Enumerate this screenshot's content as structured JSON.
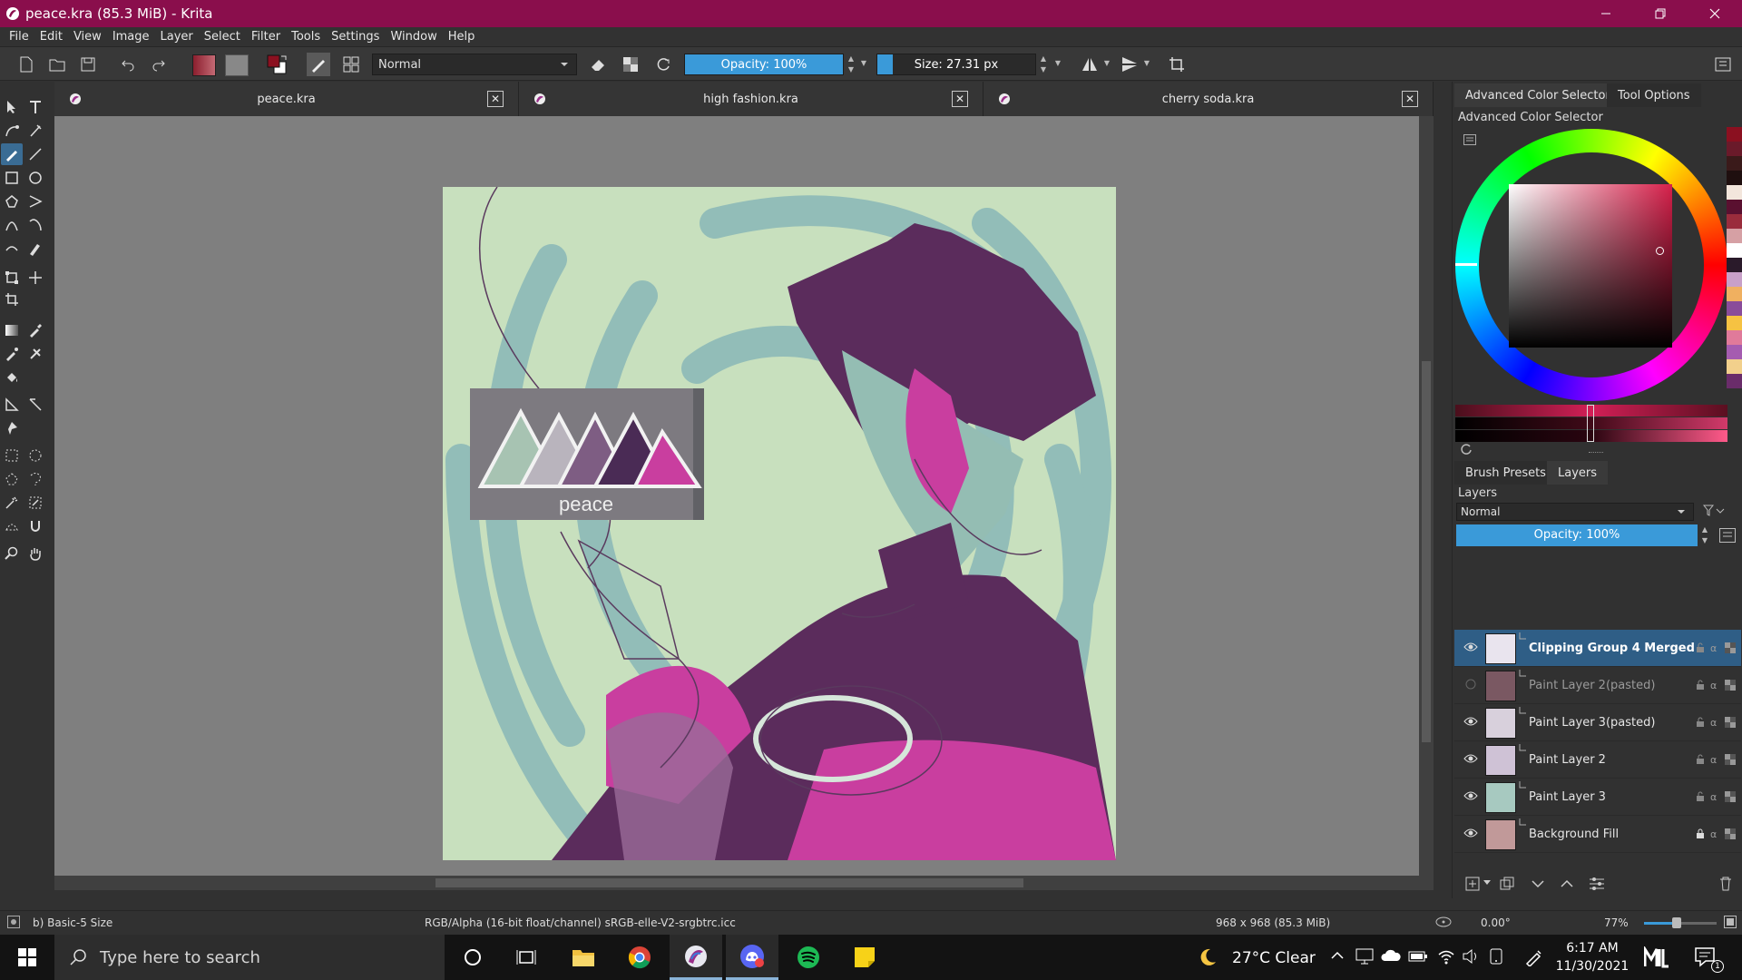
{
  "window": {
    "title": "peace.kra (85.3 MiB) - Krita",
    "accent_color": "#8a0e4c"
  },
  "menu": [
    "File",
    "Edit",
    "View",
    "Image",
    "Layer",
    "Select",
    "Filter",
    "Tools",
    "Settings",
    "Window",
    "Help"
  ],
  "toolbar": {
    "blend_mode": "Normal",
    "opacity_label": "Opacity: 100%",
    "opacity_value": 100,
    "size_label": "Size: 27.31 px",
    "size_fraction": 0.1
  },
  "document_tabs": [
    {
      "label": "peace.kra"
    },
    {
      "label": "high fashion.kra"
    },
    {
      "label": "cherry soda.kra"
    }
  ],
  "artwork": {
    "sign_text": "peace"
  },
  "dock": {
    "top_tabs": [
      "Advanced Color Selector",
      "Tool Options"
    ],
    "color_selector_title": "Advanced Color Selector",
    "bottom_tabs": [
      "Brush Presets",
      "Layers"
    ],
    "layers_title": "Layers",
    "layer_blend_mode": "Normal",
    "layer_opacity_label": "Opacity:  100%",
    "layers": [
      {
        "name": "Clipping Group 4 Merged",
        "visible": true,
        "selected": true,
        "locked": false,
        "thumb": "#e9e4ee"
      },
      {
        "name": "Paint Layer 2(pasted)",
        "visible": false,
        "selected": false,
        "locked": false,
        "thumb": "#7a5862"
      },
      {
        "name": "Paint Layer 3(pasted)",
        "visible": true,
        "selected": false,
        "locked": false,
        "thumb": "#d8d0dc"
      },
      {
        "name": "Paint Layer 2",
        "visible": true,
        "selected": false,
        "locked": false,
        "thumb": "#cfc2d6"
      },
      {
        "name": "Paint Layer 3",
        "visible": true,
        "selected": false,
        "locked": false,
        "thumb": "#a7c9c0"
      },
      {
        "name": "Background Fill",
        "visible": true,
        "selected": false,
        "locked": true,
        "thumb": "#c19999"
      }
    ]
  },
  "status": {
    "brush": "b) Basic-5 Size",
    "color_space": "RGB/Alpha (16-bit float/channel)  sRGB-elle-V2-srgbtrc.icc",
    "image_size": "968 x 968 (85.3 MiB)",
    "rotation": "0.00°",
    "zoom": "77%",
    "zoom_fraction": 0.45
  },
  "taskbar": {
    "search_placeholder": "Type here to search",
    "weather": "27°C  Clear",
    "time": "6:17 AM",
    "date": "11/30/2021",
    "notification_count": "1"
  }
}
